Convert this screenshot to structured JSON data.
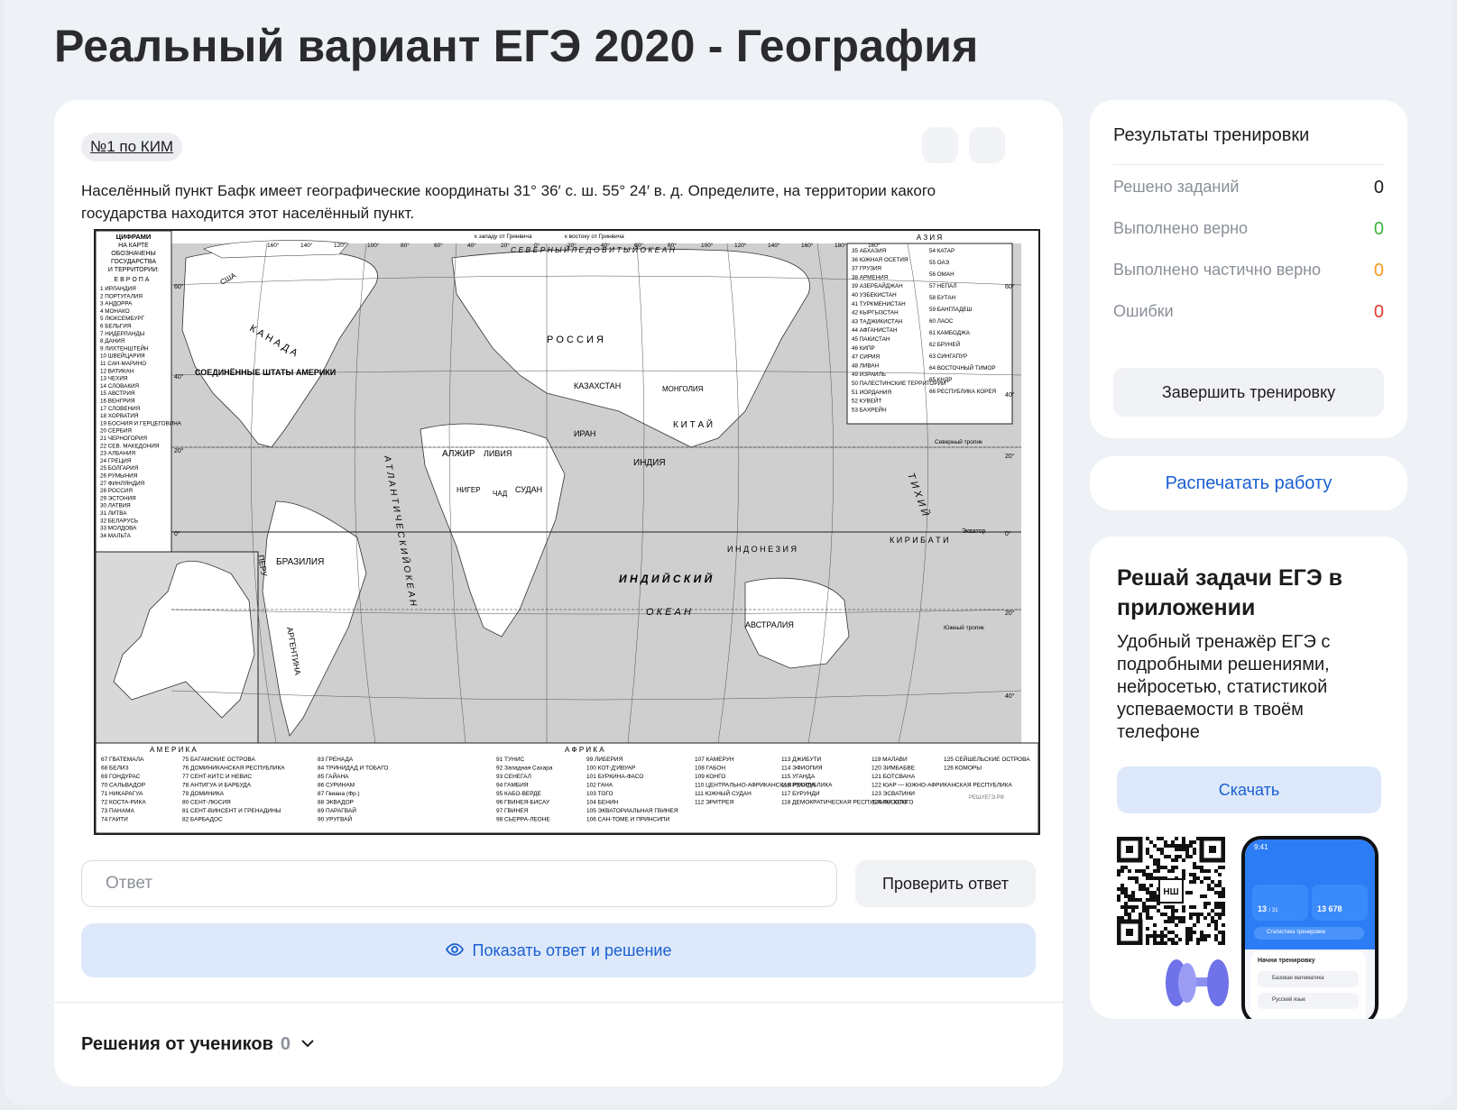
{
  "page": {
    "title": "Реальный вариант ЕГЭ 2020 - География"
  },
  "task": {
    "badge": "№1 по КИМ",
    "text": "Населённый пункт Бафк имеет географические координаты 31° 36′ с. ш. 55° 24′ в. д. Определите, на территории какого государства находится этот населённый пункт.",
    "answer_placeholder": "Ответ",
    "check_label": "Проверить ответ",
    "show_label": "Показать ответ и решение",
    "student_solutions_label": "Решения от учеников",
    "student_solutions_count": "0"
  },
  "map": {
    "legend_title": "ЦИФРАМИ НА КАРТЕ ОБОЗНАЧЕНЫ ГОСУДАРСТВА И ТЕРРИТОРИИ:",
    "europe_label": "Е В Р О П А",
    "asia_label": "А З И Я",
    "america_label": "А М Е Р И К А",
    "africa_label": "А Ф Р И К А",
    "west_label": "к западу от Гринвича",
    "east_label": "к востоку от Гринвича",
    "arctic_label": "С Е В Е Р Н Ы Й   Л Е Д О В И Т Ы Й   О К Е А Н",
    "atlantic_label": "А Т Л А Н Т И Ч Е С К И Й   О К Е А Н",
    "indian_label": "И Н Д И Й С К И Й",
    "indian_label2": "О К Е А Н",
    "pacific_label": "Т И Х И Й",
    "russia_label": "Р О С С И Я",
    "canada_label": "К А Н А Д А",
    "usa_label": "СОЕДИНЁННЫЕ ШТАТЫ АМЕРИКИ",
    "usa_short": "США",
    "brazil_label": "БРАЗИЛИЯ",
    "argentina_label": "АРГЕНТИНА",
    "peru_label": "ПЕРУ",
    "kazakhstan_label": "КАЗАХСТАН",
    "mongolia_label": "МОНГОЛИЯ",
    "china_label": "К И Т А Й",
    "india_label": "ИНДИЯ",
    "iran_label": "ИРАН",
    "algeria_label": "АЛЖИР",
    "libya_label": "ЛИВИЯ",
    "sudan_label": "СУДАН",
    "niger_label": "НИГЕР",
    "chad_label": "ЧАД",
    "australia_label": "АВСТРАЛИЯ",
    "indonesia_label": "И Н Д О Н Е З И Я",
    "kiribati_label": "К И Р И Б А Т И",
    "equator_label": "Экватор",
    "north_tropic": "Северный тропик",
    "south_tropic": "Южный тропик",
    "watermark": "РЕШУЕГЭ.РФ",
    "europe_list": [
      "1 ИРЛАНДИЯ",
      "2 ПОРТУГАЛИЯ",
      "3 АНДОРРА",
      "4 МОНАКО",
      "5 ЛЮКСЕМБУРГ",
      "6 БЕЛЬГИЯ",
      "7 НИДЕРЛАНДЫ",
      "8 ДАНИЯ",
      "9 ЛИХТЕНШТЕЙН",
      "10 ШВЕЙЦАРИЯ",
      "11 САН-МАРИНО",
      "12 ВАТИКАН",
      "13 ЧЕХИЯ",
      "14 СЛОВАКИЯ",
      "15 АВСТРИЯ",
      "16 ВЕНГРИЯ",
      "17 СЛОВЕНИЯ",
      "18 ХОРВАТИЯ",
      "19 БОСНИЯ И ГЕРЦЕГОВИНА",
      "20 СЕРБИЯ",
      "21 ЧЕРНОГОРИЯ",
      "22 СЕВ. МАКЕДОНИЯ",
      "23 АЛБАНИЯ",
      "24 ГРЕЦИЯ",
      "25 БОЛГАРИЯ",
      "26 РУМЫНИЯ",
      "27 ФИНЛЯНДИЯ",
      "28 РОССИЯ",
      "29 ЭСТОНИЯ",
      "30 ЛАТВИЯ",
      "31 ЛИТВА",
      "32 БЕЛАРУСЬ",
      "33 МОЛДОВА",
      "34 МАЛЬТА"
    ],
    "asia_list_1": [
      "35 АБХАЗИЯ",
      "36 ЮЖНАЯ ОСЕТИЯ",
      "37 ГРУЗИЯ",
      "38 АРМЕНИЯ",
      "39 АЗЕРБАЙДЖАН",
      "40 УЗБЕКИСТАН",
      "41 ТУРКМЕНИСТАН",
      "42 КЫРГЫЗСТАН",
      "43 ТАДЖИКИСТАН",
      "44 АФГАНИСТАН",
      "45 ПАКИСТАН",
      "46 КИПР",
      "47 СИРИЯ",
      "48 ЛИВАН",
      "49 ИЗРАИЛЬ",
      "50 ПАЛЕСТИНСКИЕ ТЕРРИТОРИИ",
      "51 ИОРДАНИЯ",
      "52 КУВЕЙТ",
      "53 БАХРЕЙН"
    ],
    "asia_list_2": [
      "54 КАТАР",
      "55 ОАЭ",
      "56 ОМАН",
      "57 НЕПАЛ",
      "58 БУТАН",
      "59 БАНГЛАДЕШ",
      "60 ЛАОС",
      "61 КАМБОДЖА",
      "62 БРУНЕЙ",
      "63 СИНГАПУР",
      "64 ВОСТОЧНЫЙ ТИМОР",
      "65 КНДР",
      "66 РЕСПУБЛИКА КОРЕЯ"
    ],
    "america_list": [
      "67 ГВАТЕМАЛА",
      "68 БЕЛИЗ",
      "69 ГОНДУРАС",
      "70 САЛЬВАДОР",
      "71 НИКАРАГУА",
      "72 КОСТА-РИКА",
      "73 ПАНАМА",
      "74 ГАИТИ"
    ],
    "america_list_2": [
      "75 БАГАМСКИЕ ОСТРОВА",
      "76 ДОМИНИКАНСКАЯ РЕСПУБЛИКА",
      "77 СЕНТ-КИТС И НЕВИС",
      "78 АНТИГУА И БАРБУДА",
      "79 ДОМИНИКА",
      "80 СЕНТ-ЛЮСИЯ",
      "81 СЕНТ-ВИНСЕНТ И ГРЕНАДИНЫ",
      "82 БАРБАДОС"
    ],
    "america_list_3": [
      "83 ГРЕНАДА",
      "84 ТРИНИДАД И ТОБАГО",
      "85 ГАЙАНА",
      "86 СУРИНАМ",
      "87 Гвиана (Фр.)",
      "88 ЭКВАДОР",
      "89 ПАРАГВАЙ",
      "90 УРУГВАЙ"
    ],
    "africa_list_1": [
      "91 ТУНИС",
      "92 Западная Сахара",
      "93 СЕНЕГАЛ",
      "94 ГАМБИЯ",
      "95 КАБО-ВЕРДЕ",
      "96 ГВИНЕЯ-БИСАУ",
      "97 ГВИНЕЯ",
      "98 СЬЕРРА-ЛЕОНЕ"
    ],
    "africa_list_2": [
      "99 ЛИБЕРИЯ",
      "100 КОТ-Д'ИВУАР",
      "101 БУРКИНА-ФАСО",
      "102 ГАНА",
      "103 ТОГО",
      "104 БЕНИН",
      "105 ЭКВАТОРИАЛЬНАЯ ГВИНЕЯ",
      "106 САН-ТОМЕ И ПРИНСИПИ"
    ],
    "africa_list_3": [
      "107 КАМЕРУН",
      "108 ГАБОН",
      "109 КОНГО",
      "110 ЦЕНТРАЛЬНО-АФРИКАНСКАЯ РЕСПУБЛИКА",
      "111 ЮЖНЫЙ СУДАН",
      "112 ЭРИТРЕЯ"
    ],
    "africa_list_4": [
      "113 ДЖИБУТИ",
      "114 ЭФИОПИЯ",
      "115 УГАНДА",
      "116 РУАНДА",
      "117 БУРУНДИ",
      "118 ДЕМОКРАТИЧЕСКАЯ РЕСПУБЛИКА КОНГО"
    ],
    "africa_list_5": [
      "119 МАЛАВИ",
      "120 ЗИМБАБВЕ",
      "121 БОТСВАНА",
      "122 ЮАР — ЮЖНО-АФРИКАНСКАЯ РЕСПУБЛИКА",
      "123 ЭСВАТИНИ",
      "124 ЛЕСОТО"
    ],
    "africa_list_6": [
      "125 СЕЙШЕЛЬСКИЕ ОСТРОВА",
      "126 КОМОРЫ"
    ],
    "longitudes_top": [
      "160°",
      "140°",
      "120°",
      "100°",
      "80°",
      "60°",
      "40°",
      "20°",
      "0°",
      "20°",
      "40°",
      "60°",
      "80°",
      "100°",
      "120°",
      "140°",
      "160°",
      "180°",
      "160°"
    ],
    "latitudes_left": [
      "60°",
      "40°",
      "20°",
      "0°"
    ],
    "latitudes_right": [
      "60°",
      "40°",
      "20°",
      "0°",
      "20°",
      "40°"
    ]
  },
  "results": {
    "title": "Результаты тренировки",
    "rows": [
      {
        "label": "Решено заданий",
        "value": "0"
      },
      {
        "label": "Выполнено верно",
        "value": "0"
      },
      {
        "label": "Выполнено частично верно",
        "value": "0"
      },
      {
        "label": "Ошибки",
        "value": "0"
      }
    ],
    "colors": {
      "neutral": "#1c1c1e",
      "correct": "#3cb43c",
      "partial": "#f39a1e",
      "errors": "#e23b2e"
    },
    "finish_label": "Завершить тренировку"
  },
  "print": {
    "label": "Распечатать работу"
  },
  "app_promo": {
    "title": "Решай задачи ЕГЭ в приложении",
    "description": "Удобный тренажёр ЕГЭ с подробными решениями, нейросетью, статистикой успеваемости в твоём телефоне",
    "download_label": "Скачать",
    "qr_center": "НШ",
    "phone": {
      "time": "9:41",
      "tile1_value": "13",
      "tile1_suffix": "/ 31",
      "tile2_value": "13 678",
      "stat_label": "Статистика тренировок",
      "panel_title": "Начни тренировку",
      "row1": "Базовая математика",
      "row2": "Русский язык"
    }
  },
  "accent_color": "#1a5fd1"
}
